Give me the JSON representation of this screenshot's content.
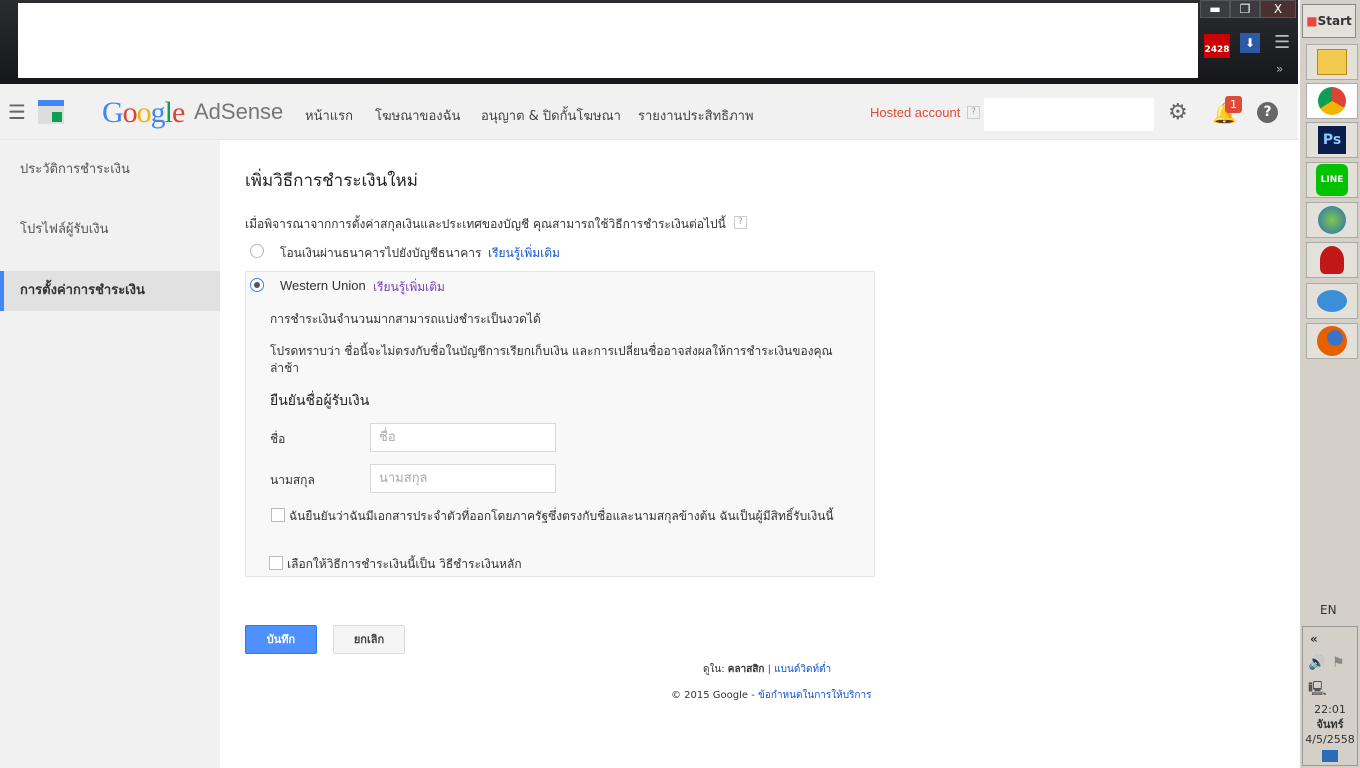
{
  "window": {
    "minimize": "▬",
    "restore": "❐",
    "close": "X",
    "mail_count": "2428",
    "more": "»"
  },
  "taskbar": {
    "start": "Start",
    "apps": [
      "explorer",
      "chrome",
      "Ps",
      "LINE",
      "internet-download-manager",
      "app-red",
      "chat",
      "firefox"
    ],
    "lang": "EN",
    "collapse": "«",
    "time": "22:01",
    "day": "จันทร์",
    "date": "4/5/2558"
  },
  "header": {
    "logo_google": "Google",
    "logo_product": "AdSense",
    "nav": [
      "หน้าแรก",
      "โฆษณาของฉัน",
      "อนุญาต & ปิดกั้นโฆษณา",
      "รายงานประสิทธิภาพ"
    ],
    "hosted": "Hosted account",
    "help_q": "?",
    "notif_count": "1"
  },
  "sidebar": {
    "items": [
      {
        "label": "ประวัติการชำระเงิน"
      },
      {
        "label": "โปรไฟล์ผู้รับเงิน"
      },
      {
        "label": "การตั้งค่าการชำระเงิน"
      }
    ]
  },
  "main": {
    "title": "เพิ่มวิธีการชำระเงินใหม่",
    "intro": "เมื่อพิจารณาจากการตั้งค่าสกุลเงินและประเทศของบัญชี คุณสามารถใช้วิธีการชำระเงินต่อไปนี้",
    "help": "?",
    "option1": {
      "label": "โอนเงินผ่านธนาคารไปยังบัญชีธนาคาร",
      "link": "เรียนรู้เพิ่มเติม"
    },
    "option2": {
      "label": "Western Union",
      "link": "เรียนรู้เพิ่มเติม",
      "note1": "การชำระเงินจำนวนมากสามารถแบ่งชำระเป็นงวดได้",
      "note2a": "โปรดทราบว่า ชื่อนี้จะไม่ตรงกับชื่อในบัญชีการเรียกเก็บเงิน และการเปลี่ยนชื่ออาจส่งผลให้การชำระเงินของคุณ",
      "note2b": "ล่าช้า",
      "verify_title": "ยืนยันชื่อผู้รับเงิน",
      "first_label": "ชื่อ",
      "first_placeholder": "ชื่อ",
      "last_label": "นามสกุล",
      "last_placeholder": "นามสกุล",
      "confirm": "ฉันยืนยันว่าฉันมีเอกสารประจำตัวที่ออกโดยภาครัฐซึ่งตรงกับชื่อและนามสกุลข้างต้น ฉันเป็นผู้มีสิทธิ์รับเงินนี้",
      "primary": "เลือกให้วิธีการชำระเงินนี้เป็น วิธีชำระเงินหลัก"
    },
    "save": "บันทึก",
    "cancel": "ยกเลิก"
  },
  "footer": {
    "view_in": "ดูใน:",
    "classic": "คลาสสิก",
    "sep": "|",
    "bandwidth": "แบนด์วิดท์ต่ำ",
    "copyright": "© 2015 Google -",
    "terms": "ข้อกำหนดในการให้บริการ"
  }
}
